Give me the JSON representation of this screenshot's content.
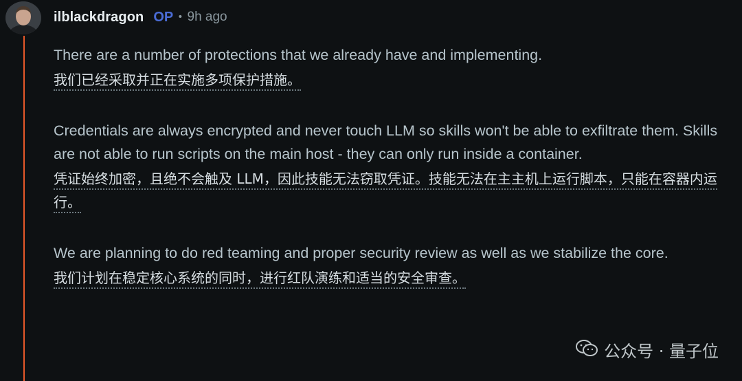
{
  "comment": {
    "author": "ilblackdragon",
    "op_badge": "OP",
    "separator": "•",
    "time_ago": "9h ago",
    "avatar_icon": "user-avatar",
    "thread_line_color": "#e8592a",
    "paragraphs": [
      {
        "en": "There are a number of protections that we already have and implementing.",
        "zh": "我们已经采取并正在实施多项保护措施。"
      },
      {
        "en": "Credentials are always encrypted and never touch LLM so skills won't be able to exfiltrate them. Skills are not able to run scripts on the main host - they can only run inside a container.",
        "zh": "凭证始终加密，且绝不会触及 LLM，因此技能无法窃取凭证。技能无法在主主机上运行脚本，只能在容器内运行。"
      },
      {
        "en": "We are planning to do red teaming and proper security review as well as we stabilize the core.",
        "zh": "我们计划在稳定核心系统的同时，进行红队演练和适当的安全审查。"
      }
    ]
  },
  "watermark": {
    "icon": "wechat-icon",
    "text": "公众号 · 量子位"
  }
}
